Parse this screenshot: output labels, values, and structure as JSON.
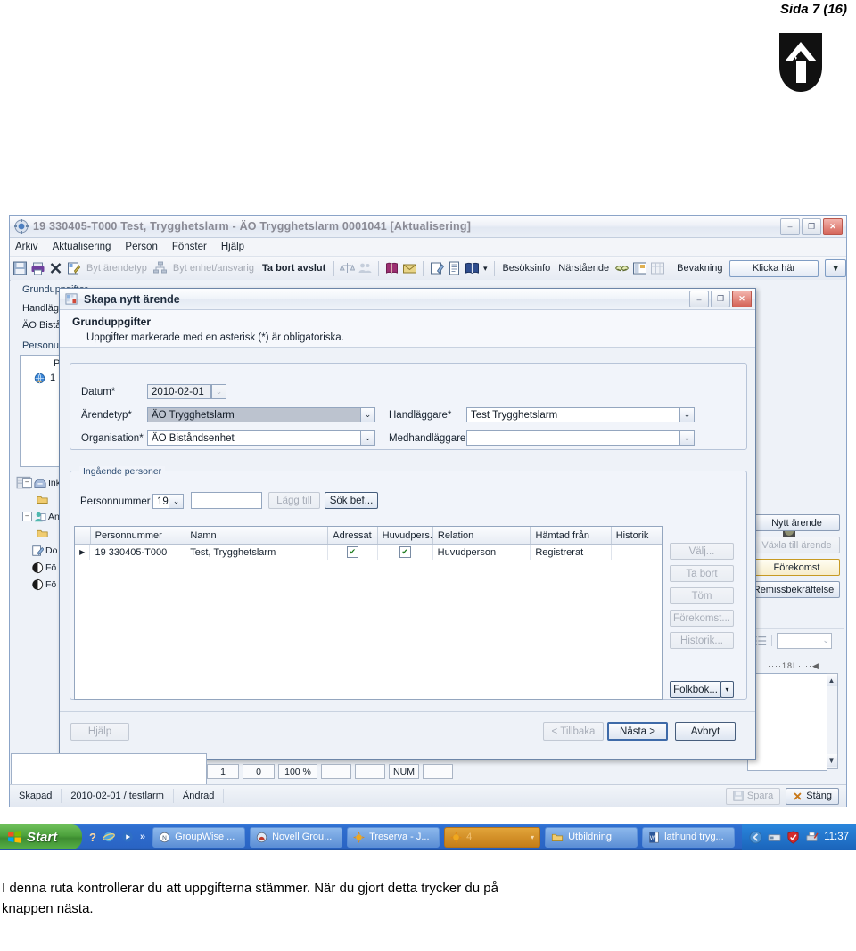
{
  "document": {
    "page_label": "Sida 7 (16)",
    "caption_line1": "I denna ruta kontrollerar du att uppgifterna stämmer. När du gjort detta trycker du på",
    "caption_line2": "knappen nästa."
  },
  "app_window": {
    "title": "19 330405-T000   Test, Trygghetslarm   -   ÄO Trygghetslarm   0001041   [Aktualisering]",
    "icon": "application-icon",
    "minimize": "–",
    "maximize": "❐",
    "close": "✕",
    "menu": [
      "Arkiv",
      "Aktualisering",
      "Person",
      "Fönster",
      "Hjälp"
    ],
    "toolbar": {
      "byt_arendetyp": "Byt ärendetyp",
      "byt_enhet": "Byt enhet/ansvarig",
      "ta_bort_avslut": "Ta bort avslut",
      "besoksinfo": "Besöksinfo",
      "narstaende": "Närstående",
      "bevakning_label": "Bevakning",
      "bevakning_button": "Klicka här",
      "bevakning_drop": "▼"
    },
    "background_form": {
      "group_grunduppgifter": "Grunduppgifter",
      "handlaggare_label": "Handläggare",
      "organisation_value": "ÄO Biståndsenhet",
      "group_personuppgifter": "Personuppgifter",
      "col_person": "P"
    },
    "tree": [
      {
        "label": "Ink",
        "icon": "inbox-icon"
      },
      {
        "label": "An",
        "icon": "person-icon"
      },
      {
        "label": "Do",
        "icon": "document-icon"
      },
      {
        "label": "Fö",
        "icon": "bullet-icon"
      },
      {
        "label": "Fö",
        "icon": "bullet-icon"
      }
    ],
    "side_buttons": [
      {
        "label": "Nytt ärende",
        "state": "enabled"
      },
      {
        "label": "Växla till ärende",
        "state": "disabled"
      },
      {
        "label": "Förekomst",
        "state": "highlighted"
      },
      {
        "label": "Remissbekräftelse",
        "state": "enabled"
      }
    ],
    "ruler_mark": "18",
    "status_cells": [
      "1",
      "0",
      "100 %",
      "",
      "",
      "NUM",
      ""
    ],
    "bottom_bar": {
      "skapad_label": "Skapad",
      "skapad_value": "2010-02-01 / testlarm",
      "andrad_label": "Ändrad",
      "spara": "Spara",
      "stang": "Stäng"
    }
  },
  "dialog": {
    "title": "Skapa nytt ärende",
    "title_icon": "wizard-icon",
    "minimize": "–",
    "maximize": "❐",
    "close": "✕",
    "heading": "Grunduppgifter",
    "subheading": "Uppgifter markerade med en asterisk (*) är obligatoriska.",
    "fields": {
      "datum_label": "Datum*",
      "datum_value": "2010-02-01",
      "arendetyp_label": "Ärendetyp*",
      "arendetyp_value": "ÄO Trygghetslarm",
      "organisation_label": "Organisation*",
      "organisation_value": "ÄO Biståndsenhet",
      "handlaggare_label": "Handläggare*",
      "handlaggare_value": "Test Trygghetslarm",
      "medhandlaggare_label": "Medhandläggare",
      "medhandlaggare_value": "",
      "dropdown_caret": "⌄"
    },
    "persons_group": {
      "caption": "Ingående personer",
      "personnummer_label": "Personnummer",
      "prefix_value": "19",
      "prefix_caret": "⌄",
      "input_value": "",
      "lagg_till": "Lägg till",
      "sok_bef": "Sök bef..."
    },
    "grid": {
      "columns": [
        "Personnummer",
        "Namn",
        "Adressat",
        "Huvudpers.",
        "Relation",
        "Hämtad från",
        "Historik"
      ],
      "rows": [
        {
          "marker": "▶",
          "personnummer": "19 330405-T000",
          "namn": "Test, Trygghetslarm",
          "adressat": true,
          "huvudpers": true,
          "relation": "Huvudperson",
          "hamtad_fran": "Registrerat",
          "historik": ""
        }
      ],
      "check_glyph": "✔"
    },
    "side_buttons": [
      {
        "label": "Välj...",
        "state": "disabled"
      },
      {
        "label": "Ta bort",
        "state": "disabled"
      },
      {
        "label": "Töm",
        "state": "disabled"
      },
      {
        "label": "Förekomst...",
        "state": "disabled"
      },
      {
        "label": "Historik...",
        "state": "disabled"
      }
    ],
    "folkbok_button": "Folkbok...",
    "folkbok_caret": "▾",
    "footer": {
      "hjalp": "Hjälp",
      "tillbaka": "< Tillbaka",
      "nasta": "Nästa >",
      "avbryt": "Avbryt"
    }
  },
  "taskbar": {
    "start": "Start",
    "quick_icons": [
      "help-icon",
      "internet-explorer-icon",
      "media-player-icon",
      "chevron-double-right-icon"
    ],
    "items": [
      {
        "label": "GroupWise ...",
        "icon": "groupwise-icon",
        "active": false
      },
      {
        "label": "Novell Grou...",
        "icon": "novell-icon",
        "active": false
      },
      {
        "label": "Treserva - J...",
        "icon": "treserva-icon",
        "active": false
      },
      {
        "label": "4",
        "icon": "treserva-icon",
        "active": true
      },
      {
        "label": "Utbildning",
        "icon": "folder-icon",
        "active": false
      },
      {
        "label": "lathund tryg...",
        "icon": "word-icon",
        "active": false
      }
    ],
    "tray_icons": [
      "show-desktop-icon",
      "network-icon",
      "shield-icon",
      "printer-icon"
    ],
    "clock": "11:37"
  }
}
